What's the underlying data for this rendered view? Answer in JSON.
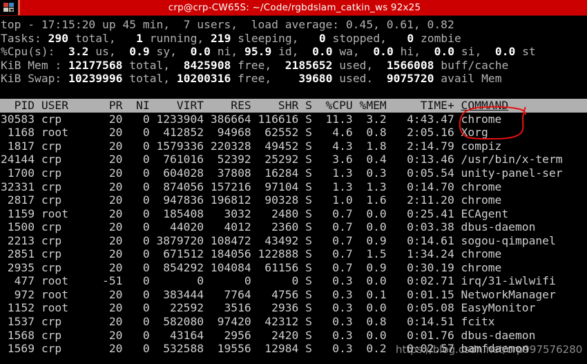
{
  "window": {
    "title": "crp@crp-CW65S: ~/Code/rgbdslam_catkin_ws 92x25",
    "titlebar_color": "#cc0000",
    "icon": "workspace-switcher-icon"
  },
  "summary": {
    "line1": {
      "prefix": "top - ",
      "time": "17:15:20",
      "uptime_label": " up ",
      "uptime": "45 min",
      "users_sep": ",  ",
      "users": "7 users",
      "load_label": ",  load average: ",
      "load": "0.45, 0.61, 0.82",
      "full": "top - 17:15:20 up 45 min,  7 users,  load average: 0.45, 0.61, 0.82"
    },
    "tasks": {
      "label": "Tasks:",
      "total": "290",
      "total_label": "total,",
      "running": "1",
      "running_label": "running,",
      "sleeping": "219",
      "sleeping_label": "sleeping,",
      "stopped": "0",
      "stopped_label": "stopped,",
      "zombie": "0",
      "zombie_label": "zombie"
    },
    "cpu": {
      "label": "%Cpu(s):",
      "us": "3.2",
      "us_label": "us,",
      "sy": "0.9",
      "sy_label": "sy,",
      "ni": "0.0",
      "ni_label": "ni,",
      "id": "95.9",
      "id_label": "id,",
      "wa": "0.0",
      "wa_label": "wa,",
      "hi": "0.0",
      "hi_label": "hi,",
      "si": "0.0",
      "si_label": "si,",
      "st": "0.0",
      "st_label": "st"
    },
    "mem": {
      "label": "KiB Mem :",
      "total": "12177568",
      "total_label": "total,",
      "free": "8425908",
      "free_label": "free,",
      "used": "2185652",
      "used_label": "used,",
      "buff": "1566008",
      "buff_label": "buff/cache"
    },
    "swap": {
      "label": "KiB Swap:",
      "total": "10239996",
      "total_label": "total,",
      "free": "10200316",
      "free_label": "free,",
      "used": "39680",
      "used_label": "used.",
      "avail": "9075720",
      "avail_label": "avail Mem"
    }
  },
  "table": {
    "headers": [
      "PID",
      "USER",
      "PR",
      "NI",
      "VIRT",
      "RES",
      "SHR",
      "S",
      "%CPU",
      "%MEM",
      "TIME+",
      "COMMAND"
    ],
    "sort_column": "COMMAND",
    "header_line_left": "  PID USER      PR  NI    VIRT    RES    SHR S  %CPU %MEM     TIME+ ",
    "header_line_cmd": "COMMAND",
    "header_line_pad": "                 ",
    "rows": [
      {
        "pid": "30583",
        "user": "crp",
        "pr": "20",
        "ni": "0",
        "virt": "1233904",
        "res": "386664",
        "shr": "116616",
        "s": "S",
        "cpu": "11.3",
        "mem": "3.2",
        "time": "4:43.47",
        "command": "chrome",
        "line": "30583 crp       20   0 1233904 386664 116616 S  11.3  3.2   4:43.47 chrome"
      },
      {
        "pid": "1168",
        "user": "root",
        "pr": "20",
        "ni": "0",
        "virt": "412852",
        "res": "94968",
        "shr": "62552",
        "s": "S",
        "cpu": "4.6",
        "mem": "0.8",
        "time": "2:05.16",
        "command": "Xorg",
        "line": " 1168 root      20   0  412852  94968  62552 S   4.6  0.8   2:05.16 Xorg"
      },
      {
        "pid": "1817",
        "user": "crp",
        "pr": "20",
        "ni": "0",
        "virt": "1579336",
        "res": "220328",
        "shr": "49452",
        "s": "S",
        "cpu": "4.3",
        "mem": "1.8",
        "time": "2:14.79",
        "command": "compiz",
        "line": " 1817 crp       20   0 1579336 220328  49452 S   4.3  1.8   2:14.79 compiz"
      },
      {
        "pid": "24144",
        "user": "crp",
        "pr": "20",
        "ni": "0",
        "virt": "761016",
        "res": "52392",
        "shr": "25292",
        "s": "S",
        "cpu": "3.6",
        "mem": "0.4",
        "time": "0:13.46",
        "command": "/usr/bin/x-term",
        "line": "24144 crp       20   0  761016  52392  25292 S   3.6  0.4   0:13.46 /usr/bin/x-term"
      },
      {
        "pid": "1700",
        "user": "crp",
        "pr": "20",
        "ni": "0",
        "virt": "604028",
        "res": "37808",
        "shr": "16284",
        "s": "S",
        "cpu": "1.3",
        "mem": "0.3",
        "time": "0:05.54",
        "command": "unity-panel-ser",
        "line": " 1700 crp       20   0  604028  37808  16284 S   1.3  0.3   0:05.54 unity-panel-ser"
      },
      {
        "pid": "32331",
        "user": "crp",
        "pr": "20",
        "ni": "0",
        "virt": "874056",
        "res": "157216",
        "shr": "97104",
        "s": "S",
        "cpu": "1.3",
        "mem": "1.3",
        "time": "0:14.70",
        "command": "chrome",
        "line": "32331 crp       20   0  874056 157216  97104 S   1.3  1.3   0:14.70 chrome"
      },
      {
        "pid": "2817",
        "user": "crp",
        "pr": "20",
        "ni": "0",
        "virt": "947836",
        "res": "196812",
        "shr": "90328",
        "s": "S",
        "cpu": "1.0",
        "mem": "1.6",
        "time": "2:11.20",
        "command": "chrome",
        "line": " 2817 crp       20   0  947836 196812  90328 S   1.0  1.6   2:11.20 chrome"
      },
      {
        "pid": "1159",
        "user": "root",
        "pr": "20",
        "ni": "0",
        "virt": "185408",
        "res": "3032",
        "shr": "2480",
        "s": "S",
        "cpu": "0.7",
        "mem": "0.0",
        "time": "0:25.41",
        "command": "ECAgent",
        "line": " 1159 root      20   0  185408   3032   2480 S   0.7  0.0   0:25.41 ECAgent"
      },
      {
        "pid": "1500",
        "user": "crp",
        "pr": "20",
        "ni": "0",
        "virt": "44020",
        "res": "4012",
        "shr": "2360",
        "s": "S",
        "cpu": "0.7",
        "mem": "0.0",
        "time": "0:03.38",
        "command": "dbus-daemon",
        "line": " 1500 crp       20   0   44020   4012   2360 S   0.7  0.0   0:03.38 dbus-daemon"
      },
      {
        "pid": "2213",
        "user": "crp",
        "pr": "20",
        "ni": "0",
        "virt": "3879720",
        "res": "108472",
        "shr": "43492",
        "s": "S",
        "cpu": "0.7",
        "mem": "0.9",
        "time": "0:14.61",
        "command": "sogou-qimpanel",
        "line": " 2213 crp       20   0 3879720 108472  43492 S   0.7  0.9   0:14.61 sogou-qimpanel"
      },
      {
        "pid": "2851",
        "user": "crp",
        "pr": "20",
        "ni": "0",
        "virt": "671512",
        "res": "184056",
        "shr": "122888",
        "s": "S",
        "cpu": "0.7",
        "mem": "1.5",
        "time": "1:34.24",
        "command": "chrome",
        "line": " 2851 crp       20   0  671512 184056 122888 S   0.7  1.5   1:34.24 chrome"
      },
      {
        "pid": "2935",
        "user": "crp",
        "pr": "20",
        "ni": "0",
        "virt": "854292",
        "res": "104084",
        "shr": "61156",
        "s": "S",
        "cpu": "0.7",
        "mem": "0.9",
        "time": "0:30.19",
        "command": "chrome",
        "line": " 2935 crp       20   0  854292 104084  61156 S   0.7  0.9   0:30.19 chrome"
      },
      {
        "pid": "477",
        "user": "root",
        "pr": "-51",
        "ni": "0",
        "virt": "0",
        "res": "0",
        "shr": "0",
        "s": "S",
        "cpu": "0.3",
        "mem": "0.0",
        "time": "0:02.71",
        "command": "irq/31-iwlwifi",
        "line": "  477 root     -51   0       0      0      0 S   0.3  0.0   0:02.71 irq/31-iwlwifi"
      },
      {
        "pid": "972",
        "user": "root",
        "pr": "20",
        "ni": "0",
        "virt": "383444",
        "res": "7764",
        "shr": "4756",
        "s": "S",
        "cpu": "0.3",
        "mem": "0.1",
        "time": "0:01.15",
        "command": "NetworkManager",
        "line": "  972 root      20   0  383444   7764   4756 S   0.3  0.1   0:01.15 NetworkManager"
      },
      {
        "pid": "1152",
        "user": "root",
        "pr": "20",
        "ni": "0",
        "virt": "22592",
        "res": "3516",
        "shr": "2936",
        "s": "S",
        "cpu": "0.3",
        "mem": "0.0",
        "time": "0:05.08",
        "command": "EasyMonitor",
        "line": " 1152 root      20   0   22592   3516   2936 S   0.3  0.0   0:05.08 EasyMonitor"
      },
      {
        "pid": "1537",
        "user": "crp",
        "pr": "20",
        "ni": "0",
        "virt": "582080",
        "res": "97420",
        "shr": "42312",
        "s": "S",
        "cpu": "0.3",
        "mem": "0.8",
        "time": "0:14.51",
        "command": "fcitx",
        "line": " 1537 crp       20   0  582080  97420  42312 S   0.3  0.8   0:14.51 fcitx"
      },
      {
        "pid": "1568",
        "user": "crp",
        "pr": "20",
        "ni": "0",
        "virt": "43164",
        "res": "2956",
        "shr": "2420",
        "s": "S",
        "cpu": "0.3",
        "mem": "0.0",
        "time": "0:01.76",
        "command": "dbus-daemon",
        "line": " 1568 crp       20   0   43164   2956   2420 S   0.3  0.0   0:01.76 dbus-daemon"
      },
      {
        "pid": "1569",
        "user": "crp",
        "pr": "20",
        "ni": "0",
        "virt": "532588",
        "res": "19556",
        "shr": "12984",
        "s": "S",
        "cpu": "0.3",
        "mem": "0.2",
        "time": "0:02.57",
        "command": "bamfdaemon",
        "line": " 1569 crp       20   0  532588  19556  12984 S   0.3  0.2   0:02.57 bamfdaemon"
      }
    ]
  },
  "annotation": {
    "type": "hand-drawn-ellipse",
    "color": "#e81010",
    "target": "chrome"
  },
  "watermark": {
    "text": "https://blog.csdn.net/crp997576280"
  }
}
